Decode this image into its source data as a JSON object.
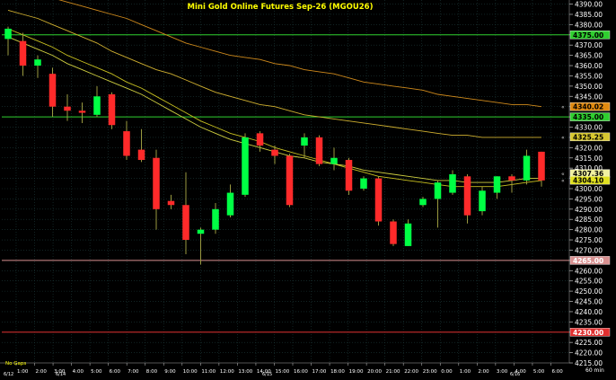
{
  "chart_data": {
    "type": "candlestick",
    "title": "Mini Gold Online Futures  Sep-26  (MGOU26)",
    "timeframe_label": "60 min",
    "no_gaps_label": "No  Gaps",
    "ylim": [
      4215,
      4392
    ],
    "y_tick_step": 5,
    "x_time_labels": [
      "1:00",
      "2:00",
      "3:00",
      "4:00",
      "5:00",
      "6:00",
      "7:00",
      "8:00",
      "9:00",
      "10:00",
      "11:00",
      "12:00",
      "13:00",
      "14:00",
      "15:00",
      "16:00",
      "17:00",
      "18:00",
      "19:00",
      "20:00",
      "21:00",
      "22:00",
      "23:00",
      "0:00",
      "1:00",
      "2:00",
      "3:00",
      "4:00",
      "5:00",
      "6:00"
    ],
    "date_markers": [
      "6/12",
      "6/14",
      "6/15",
      "6/16"
    ],
    "candles": [
      {
        "o": 4373,
        "h": 4379,
        "l": 4365,
        "c": 4378
      },
      {
        "o": 4372,
        "h": 4376,
        "l": 4355,
        "c": 4360
      },
      {
        "o": 4360,
        "h": 4365,
        "l": 4354,
        "c": 4363
      },
      {
        "o": 4356,
        "h": 4359,
        "l": 4335,
        "c": 4340
      },
      {
        "o": 4340,
        "h": 4346,
        "l": 4333,
        "c": 4338
      },
      {
        "o": 4338,
        "h": 4342,
        "l": 4332,
        "c": 4337
      },
      {
        "o": 4336,
        "h": 4350,
        "l": 4335,
        "c": 4345
      },
      {
        "o": 4346,
        "h": 4347,
        "l": 4329,
        "c": 4331
      },
      {
        "o": 4328,
        "h": 4333,
        "l": 4314,
        "c": 4316
      },
      {
        "o": 4319,
        "h": 4329,
        "l": 4313,
        "c": 4314
      },
      {
        "o": 4315,
        "h": 4319,
        "l": 4280,
        "c": 4290
      },
      {
        "o": 4294,
        "h": 4297,
        "l": 4290,
        "c": 4292
      },
      {
        "o": 4292,
        "h": 4308,
        "l": 4268,
        "c": 4275
      },
      {
        "o": 4278,
        "h": 4281,
        "l": 4263,
        "c": 4280
      },
      {
        "o": 4280,
        "h": 4293,
        "l": 4278,
        "c": 4290
      },
      {
        "o": 4287,
        "h": 4302,
        "l": 4286,
        "c": 4298
      },
      {
        "o": 4297,
        "h": 4327,
        "l": 4296,
        "c": 4325
      },
      {
        "o": 4327,
        "h": 4328,
        "l": 4318,
        "c": 4321
      },
      {
        "o": 4319,
        "h": 4321,
        "l": 4312,
        "c": 4316
      },
      {
        "o": 4316,
        "h": 4317,
        "l": 4291,
        "c": 4292
      },
      {
        "o": 4321,
        "h": 4327,
        "l": 4315,
        "c": 4325
      },
      {
        "o": 4325,
        "h": 4326,
        "l": 4311,
        "c": 4312
      },
      {
        "o": 4312,
        "h": 4320,
        "l": 4309,
        "c": 4315
      },
      {
        "o": 4314,
        "h": 4315,
        "l": 4297,
        "c": 4299
      },
      {
        "o": 4300,
        "h": 4306,
        "l": 4299,
        "c": 4305
      },
      {
        "o": 4305,
        "h": 4306,
        "l": 4282,
        "c": 4284
      },
      {
        "o": 4284,
        "h": 4285,
        "l": 4272,
        "c": 4273
      },
      {
        "o": 4272,
        "h": 4285,
        "l": 4272,
        "c": 4283
      },
      {
        "o": 4292,
        "h": 4296,
        "l": 4291,
        "c": 4295
      },
      {
        "o": 4295,
        "h": 4304,
        "l": 4281,
        "c": 4303
      },
      {
        "o": 4298,
        "h": 4309,
        "l": 4297,
        "c": 4307
      },
      {
        "o": 4306,
        "h": 4307,
        "l": 4283,
        "c": 4287
      },
      {
        "o": 4289,
        "h": 4301,
        "l": 4287,
        "c": 4299
      },
      {
        "o": 4298,
        "h": 4306,
        "l": 4295,
        "c": 4306
      },
      {
        "o": 4306,
        "h": 4307,
        "l": 4298,
        "c": 4304
      },
      {
        "o": 4304,
        "h": 4319,
        "l": 4302,
        "c": 4316
      },
      {
        "o": 4318,
        "h": 4318,
        "l": 4301,
        "c": 4304
      }
    ],
    "ma_series": [
      {
        "color": "#cf8a1c",
        "values": [
          4397,
          4396,
          4395,
          4393,
          4391,
          4389,
          4387,
          4385,
          4383,
          4380,
          4377,
          4374,
          4371,
          4369,
          4367,
          4365,
          4364,
          4363,
          4361,
          4360,
          4358,
          4357,
          4356,
          4354,
          4352,
          4351,
          4350,
          4349,
          4348,
          4346,
          4345,
          4344,
          4343,
          4342,
          4341,
          4341,
          4340
        ]
      },
      {
        "color": "#c8c020",
        "values": [
          4378,
          4375,
          4372,
          4369,
          4365,
          4362,
          4359,
          4356,
          4352,
          4349,
          4345,
          4341,
          4337,
          4333,
          4330,
          4327,
          4325,
          4323,
          4320,
          4318,
          4316,
          4314,
          4312,
          4310,
          4308,
          4306,
          4305,
          4304,
          4303,
          4302,
          4301,
          4301,
          4301,
          4301,
          4302,
          4303,
          4304
        ]
      },
      {
        "color": "#cfcf40",
        "values": [
          4374,
          4371,
          4368,
          4365,
          4361,
          4358,
          4355,
          4352,
          4349,
          4346,
          4342,
          4338,
          4334,
          4330,
          4327,
          4324,
          4322,
          4320,
          4318,
          4316,
          4315,
          4313,
          4312,
          4311,
          4309,
          4308,
          4307,
          4306,
          4305,
          4304,
          4304,
          4303,
          4303,
          4303,
          4304,
          4305,
          4305
        ]
      },
      {
        "color": "#d0b030",
        "values": [
          4387,
          4385,
          4383,
          4380,
          4377,
          4374,
          4371,
          4367,
          4364,
          4361,
          4358,
          4356,
          4353,
          4350,
          4347,
          4345,
          4343,
          4341,
          4340,
          4338,
          4336,
          4335,
          4334,
          4333,
          4332,
          4331,
          4330,
          4329,
          4328,
          4327,
          4326,
          4326,
          4325,
          4325,
          4325,
          4325,
          4325
        ]
      }
    ],
    "horizontal_levels": [
      {
        "value": 4375.0,
        "label": "4375.00",
        "color": "#2fcf2f",
        "text_color": "#000"
      },
      {
        "value": 4335.0,
        "label": "4335.00",
        "color": "#2fcf2f",
        "text_color": "#000"
      },
      {
        "value": 4265.0,
        "label": "4265.00",
        "color": "#d89090",
        "text_color": "#fff"
      },
      {
        "value": 4230.0,
        "label": "4230.00",
        "color": "#e03030",
        "text_color": "#fff"
      }
    ],
    "price_tags": [
      {
        "value": 4340.02,
        "label": "4340.02",
        "bg": "#e08a10",
        "fg": "#000"
      },
      {
        "value": 4325.25,
        "label": "4325.25",
        "bg": "#d8c830",
        "fg": "#000"
      },
      {
        "value": 4307.36,
        "label": "4307.36",
        "bg": "#f0f0a0",
        "fg": "#000"
      },
      {
        "value": 4304.1,
        "label": "4304.10",
        "bg": "#e0e020",
        "fg": "#000"
      }
    ],
    "colors": {
      "background": "#000000",
      "grid": "#1d3a3a",
      "up": "#00ff44",
      "down": "#ff2a2a",
      "wick": "#9a9a40",
      "axis_text": "#ffffff",
      "title": "#ffff00"
    }
  }
}
